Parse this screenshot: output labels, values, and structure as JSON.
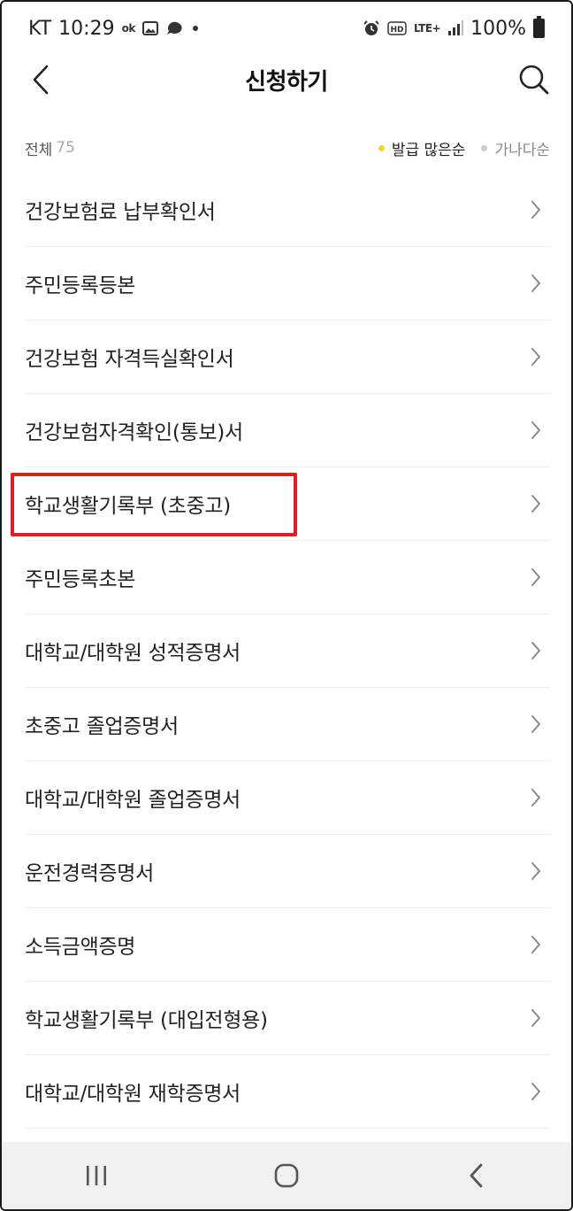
{
  "status_bar": {
    "carrier": "KT",
    "time": "10:29",
    "network": "LTE+",
    "battery": "100%"
  },
  "header": {
    "title": "신청하기"
  },
  "filter": {
    "total_label": "전체",
    "total_count": "75",
    "sort_options": [
      {
        "label": "발급 많은순",
        "active": true,
        "dot_color": "#f2d23c"
      },
      {
        "label": "가나다순",
        "active": false,
        "dot_color": "#cccccc"
      }
    ]
  },
  "list": {
    "items": [
      {
        "label": "건강보험료 납부확인서"
      },
      {
        "label": "주민등록등본"
      },
      {
        "label": "건강보험 자격득실확인서"
      },
      {
        "label": "건강보험자격확인(통보)서"
      },
      {
        "label": "학교생활기록부 (초중고)"
      },
      {
        "label": "주민등록초본"
      },
      {
        "label": "대학교/대학원 성적증명서"
      },
      {
        "label": "초중고 졸업증명서"
      },
      {
        "label": "대학교/대학원 졸업증명서"
      },
      {
        "label": "운전경력증명서"
      },
      {
        "label": "소득금액증명"
      },
      {
        "label": "학교생활기록부 (대입전형용)"
      },
      {
        "label": "대학교/대학원 재학증명서"
      }
    ]
  },
  "highlight_color": "#e0201f"
}
